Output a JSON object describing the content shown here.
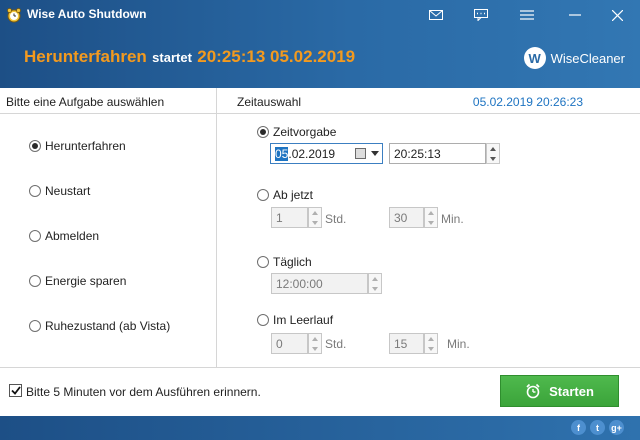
{
  "window": {
    "title": "Wise Auto Shutdown"
  },
  "banner": {
    "action": "Herunterfahren",
    "verb": "startet",
    "datetime": "20:25:13 05.02.2019",
    "brand": "WiseCleaner",
    "brand_logo": "W"
  },
  "tasks": {
    "heading": "Bitte eine Aufgabe auswählen",
    "selected": "Herunterfahren",
    "options": [
      "Herunterfahren",
      "Neustart",
      "Abmelden",
      "Energie sparen",
      "Ruhezustand (ab Vista)"
    ]
  },
  "time": {
    "heading": "Zeitauswahl",
    "current": "05.02.2019 20:26:23",
    "preset": {
      "label": "Zeitvorgabe",
      "selected": true,
      "date_selected_part": "05",
      "date_rest": ".02.2019",
      "time": "20:25:13"
    },
    "from_now": {
      "label": "Ab jetzt",
      "hours": "1",
      "hours_unit": "Std.",
      "minutes": "30",
      "minutes_unit": "Min."
    },
    "daily": {
      "label": "Täglich",
      "time": "12:00:00"
    },
    "idle": {
      "label": "Im Leerlauf",
      "hours": "0",
      "hours_unit": "Std.",
      "minutes": "15",
      "minutes_unit": "Min."
    }
  },
  "footer": {
    "reminder_label": "Bitte 5 Minuten vor dem Ausführen erinnern.",
    "reminder_checked": true,
    "start_label": "Starten"
  },
  "social": {
    "facebook": "f",
    "twitter": "t",
    "google": "g+"
  },
  "colors": {
    "titlebar": "#2a6aa6",
    "accent_orange": "#f39a1f",
    "link_blue": "#1e74c2",
    "start_green": "#3ba43a"
  }
}
